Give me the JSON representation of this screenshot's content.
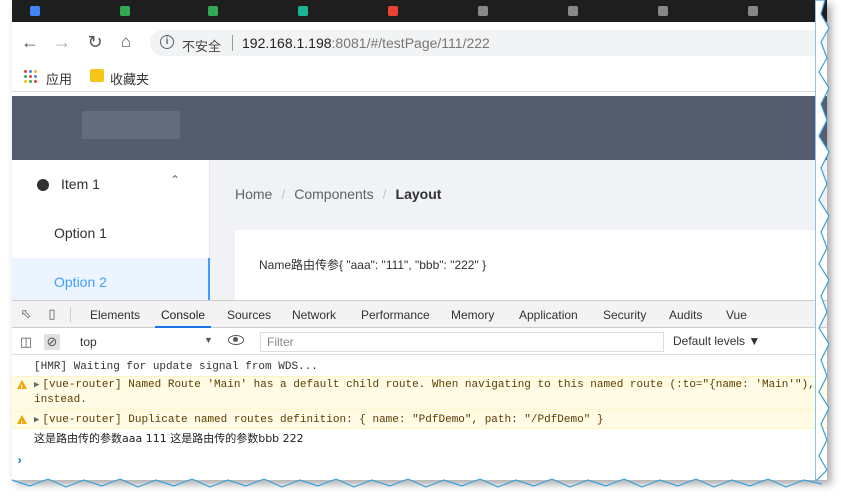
{
  "browser": {
    "address": {
      "security_label": "不安全",
      "url_host": "192.168.1.198",
      "url_rest": ":8081/#/testPage/111/222"
    },
    "bookmarks": {
      "apps_label": "应用",
      "folder_label": "收藏夹"
    }
  },
  "app": {
    "sidebar": {
      "items": [
        {
          "label": "Item 1"
        },
        {
          "label": "Option 1"
        },
        {
          "label": "Option 2"
        }
      ]
    },
    "breadcrumb": [
      "Home",
      "Components",
      "Layout"
    ],
    "breadcrumb_sep": "/",
    "card_text": "Name路由传参{ \"aaa\": \"111\", \"bbb\": \"222\" }"
  },
  "devtools": {
    "tabs": [
      "Elements",
      "Console",
      "Sources",
      "Network",
      "Performance",
      "Memory",
      "Application",
      "Security",
      "Audits",
      "Vue"
    ],
    "active_tab": "Console",
    "context": "top",
    "filter_placeholder": "Filter",
    "levels_label": "Default levels ▼",
    "console": {
      "lines": [
        {
          "type": "log",
          "text": "[HMR] Waiting for update signal from WDS..."
        },
        {
          "type": "warn",
          "text": "[vue-router] Named Route 'Main' has a default child route. When navigating to this named route (:to=\"{name: 'Main'\"), instead."
        },
        {
          "type": "warn",
          "text": "[vue-router] Duplicate named routes definition: { name: \"PdfDemo\", path: \"/PdfDemo\" }"
        },
        {
          "type": "log",
          "text": "这是路由传的参数aaa 111 这是路由传的参数bbb 222"
        }
      ],
      "prompt": "›"
    }
  },
  "colors": {
    "header_bg": "#545c6e",
    "accent": "#409eff",
    "warn_bg": "#fffbe5"
  }
}
